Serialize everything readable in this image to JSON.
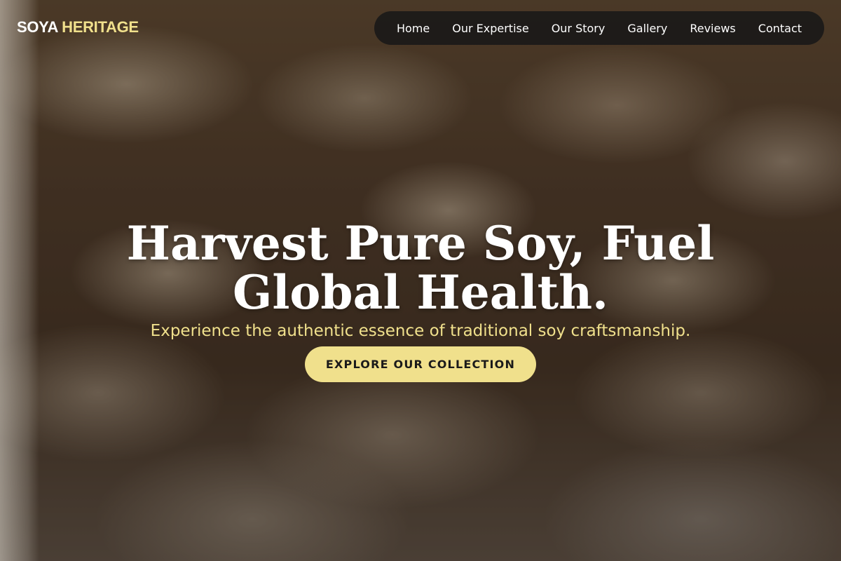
{
  "brand": {
    "name_part1": "SOYA",
    "name_part2": "HERITAGE"
  },
  "nav": {
    "items": [
      {
        "label": "Home"
      },
      {
        "label": "Our Expertise"
      },
      {
        "label": "Our Story"
      },
      {
        "label": "Gallery"
      },
      {
        "label": "Reviews"
      },
      {
        "label": "Contact"
      }
    ]
  },
  "hero": {
    "headline_line1": "Harvest Pure Soy, Fuel",
    "headline_line2": "Global Health.",
    "subtitle": "Experience the authentic essence of traditional soy craftsmanship.",
    "cta_label": "EXPLORE OUR COLLECTION"
  },
  "colors": {
    "accent": "#f0e08c",
    "nav_background": "#181818",
    "text_primary": "#ffffff"
  }
}
